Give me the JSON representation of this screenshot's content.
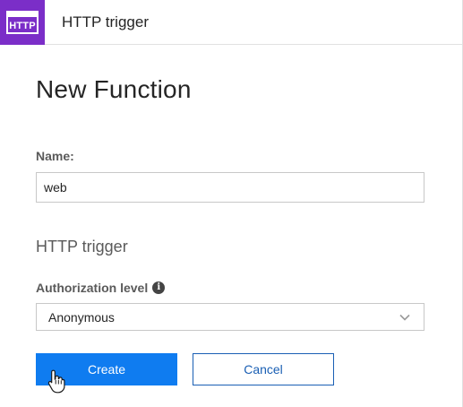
{
  "header": {
    "badge_text": "HTTP",
    "badge_icon": "http-trigger-icon",
    "title": "HTTP trigger",
    "badge_color": "#7b2ec8"
  },
  "main": {
    "page_title": "New Function",
    "name_label": "Name:",
    "name_value": "web",
    "section_heading": "HTTP trigger",
    "auth_label": "Authorization level",
    "auth_info_icon": "info-icon",
    "auth_selected": "Anonymous"
  },
  "actions": {
    "create_label": "Create",
    "cancel_label": "Cancel",
    "primary_color": "#0f7cf0",
    "link_color": "#1a5fb4"
  },
  "cursor": {
    "icon": "hand-pointer-icon"
  }
}
